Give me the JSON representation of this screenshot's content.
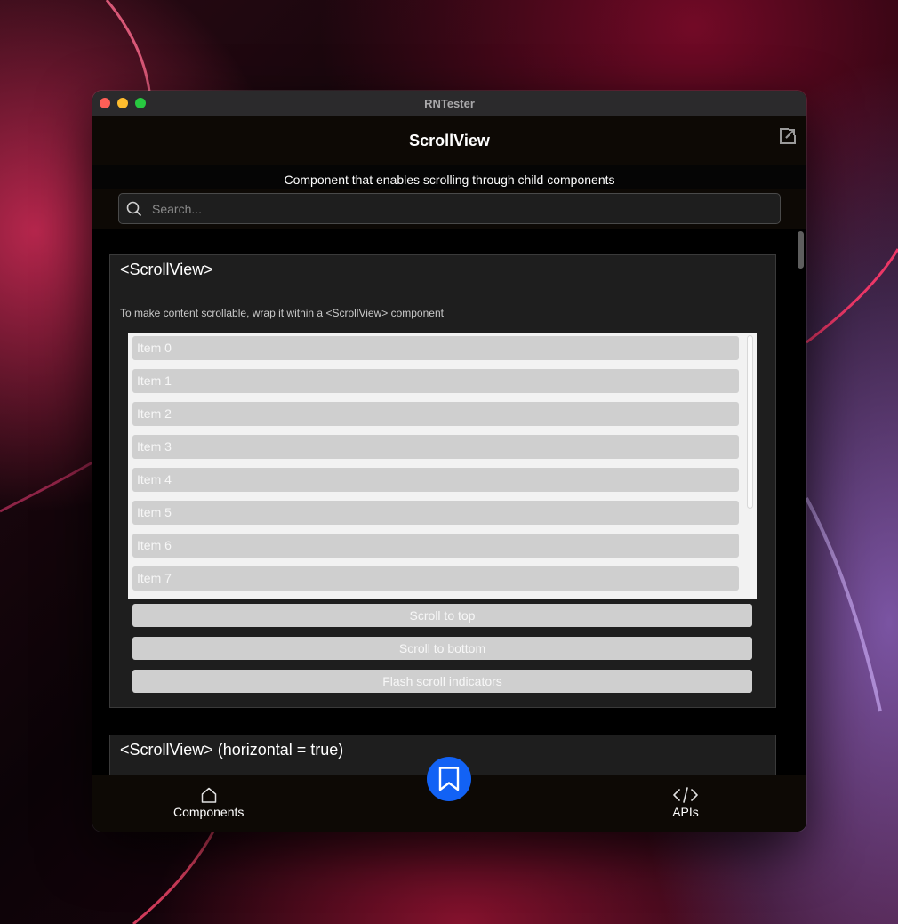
{
  "window": {
    "title": "RNTester"
  },
  "navbar": {
    "title": "ScrollView"
  },
  "subtitle": "Component that enables scrolling through child components",
  "search": {
    "placeholder": "Search...",
    "value": ""
  },
  "cards": [
    {
      "title": "<ScrollView>",
      "description": "To make content scrollable, wrap it within a <ScrollView> component",
      "items": [
        "Item 0",
        "Item 1",
        "Item 2",
        "Item 3",
        "Item 4",
        "Item 5",
        "Item 6",
        "Item 7"
      ],
      "buttons": [
        "Scroll to top",
        "Scroll to bottom",
        "Flash scroll indicators"
      ]
    },
    {
      "title": "<ScrollView> (horizontal = true)"
    }
  ],
  "tabs": {
    "components": "Components",
    "apis": "APIs"
  },
  "icons": {
    "open": "external-link-icon",
    "search": "search-icon",
    "home": "home-icon",
    "code": "code-icon",
    "bookmark": "bookmark-icon"
  },
  "colors": {
    "accent": "#1262f5",
    "item_bg": "#cfcfcf",
    "card_bg": "#1e1e1e"
  }
}
